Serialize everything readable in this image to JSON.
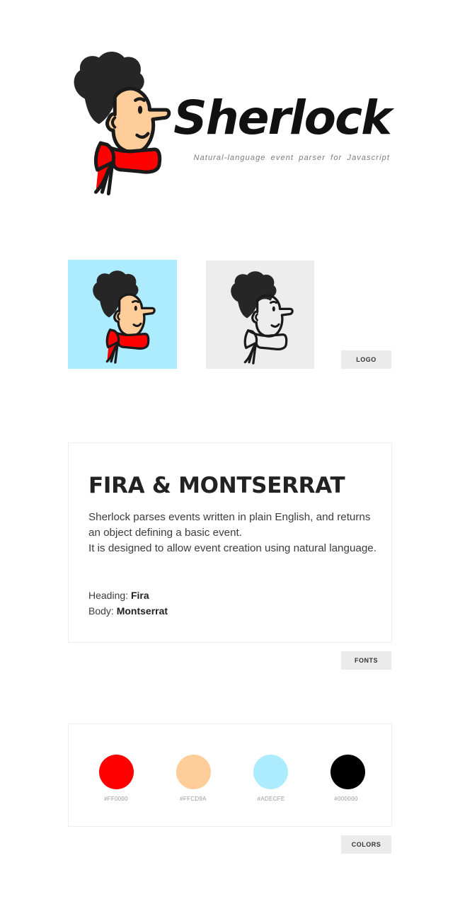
{
  "brand": {
    "name": "Sherlock",
    "tagline": "Natural-language event parser for Javascript"
  },
  "sections": {
    "logo_label": "LOGO",
    "fonts_label": "FONTS",
    "colors_label": "COLORS"
  },
  "fonts": {
    "heading": "FIRA & MONTSERRAT",
    "body_line_1": "Sherlock parses events written in plain English, and returns an object defining a basic event.",
    "body_line_2": "It is designed to allow event creation using natural language.",
    "heading_font_label": "Heading:",
    "heading_font_name": "Fira",
    "body_font_label": "Body:",
    "body_font_name": "Montserrat"
  },
  "colors": {
    "red": "#FF0000",
    "peach": "#FFCD9A",
    "blue": "#ADECFE",
    "black": "#000000",
    "tile_grey": "#EDEDED"
  },
  "palette": [
    {
      "code": "#FF0000",
      "color": "#FF0000"
    },
    {
      "code": "#FFCD9A",
      "color": "#FFCD9A"
    },
    {
      "code": "#ADECFE",
      "color": "#ADECFE"
    },
    {
      "code": "#000000",
      "color": "#000000"
    }
  ]
}
